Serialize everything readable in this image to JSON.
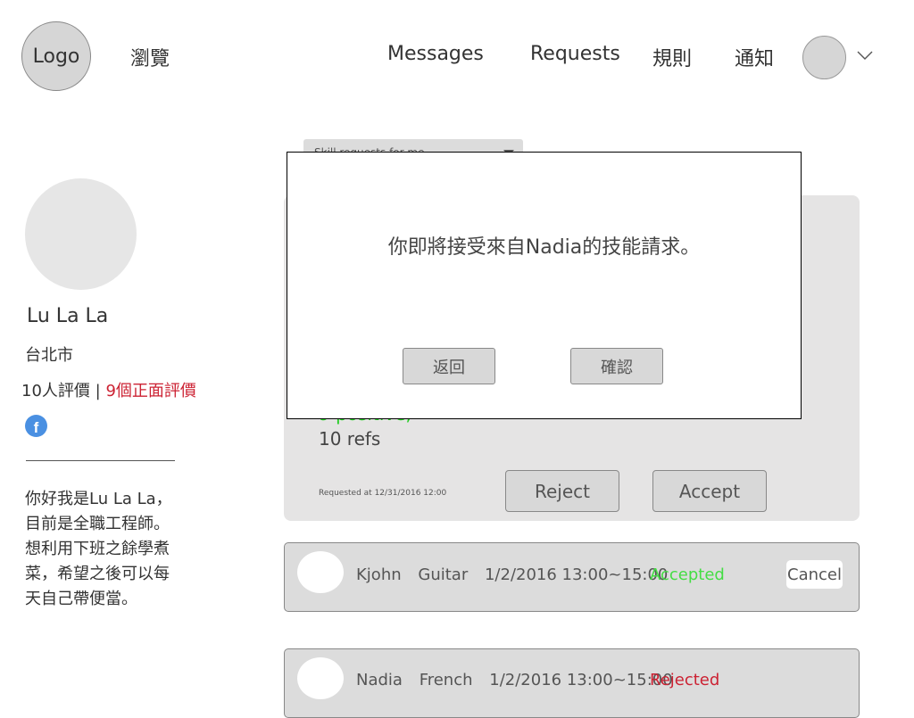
{
  "header": {
    "logo": "Logo",
    "browse": "瀏覽",
    "nav": {
      "messages": "Messages",
      "requests": "Requests",
      "rules": "規則",
      "notifications": "通知"
    }
  },
  "profile": {
    "name": "Lu La La",
    "city": "台北市",
    "reviews_count": "10人評價",
    "reviews_sep": "|",
    "positive_reviews": "9個正面評價",
    "facebook_glyph": "f",
    "bio": "你好我是Lu La La，目前是全職工程師。想利用下班之餘學煮菜，希望之後可以每天自己帶便當。"
  },
  "filter": {
    "selected": "Skill requests for me"
  },
  "request_card": {
    "positive": "9 positive,",
    "refs": "10 refs",
    "requested_at": "Requested at 12/31/2016 12:00",
    "reject_label": "Reject",
    "accept_label": "Accept"
  },
  "request_rows": [
    {
      "user": "Kjohn",
      "skill": "Guitar",
      "time": "1/2/2016 13:00~15:00",
      "status": "Accepted",
      "status_color": "#44dd44",
      "cancel_label": "Cancel"
    },
    {
      "user": "Nadia",
      "skill": "French",
      "time": "1/2/2016 13:00~15:00",
      "status": "Rejected",
      "status_color": "#cc2233"
    }
  ],
  "modal": {
    "message": "你即將接受來自Nadia的技能請求。",
    "back_label": "返回",
    "confirm_label": "確認"
  },
  "colors": {
    "accent_negative": "#cc2233",
    "accent_positive": "#22cc22",
    "facebook": "#4a90e2"
  }
}
